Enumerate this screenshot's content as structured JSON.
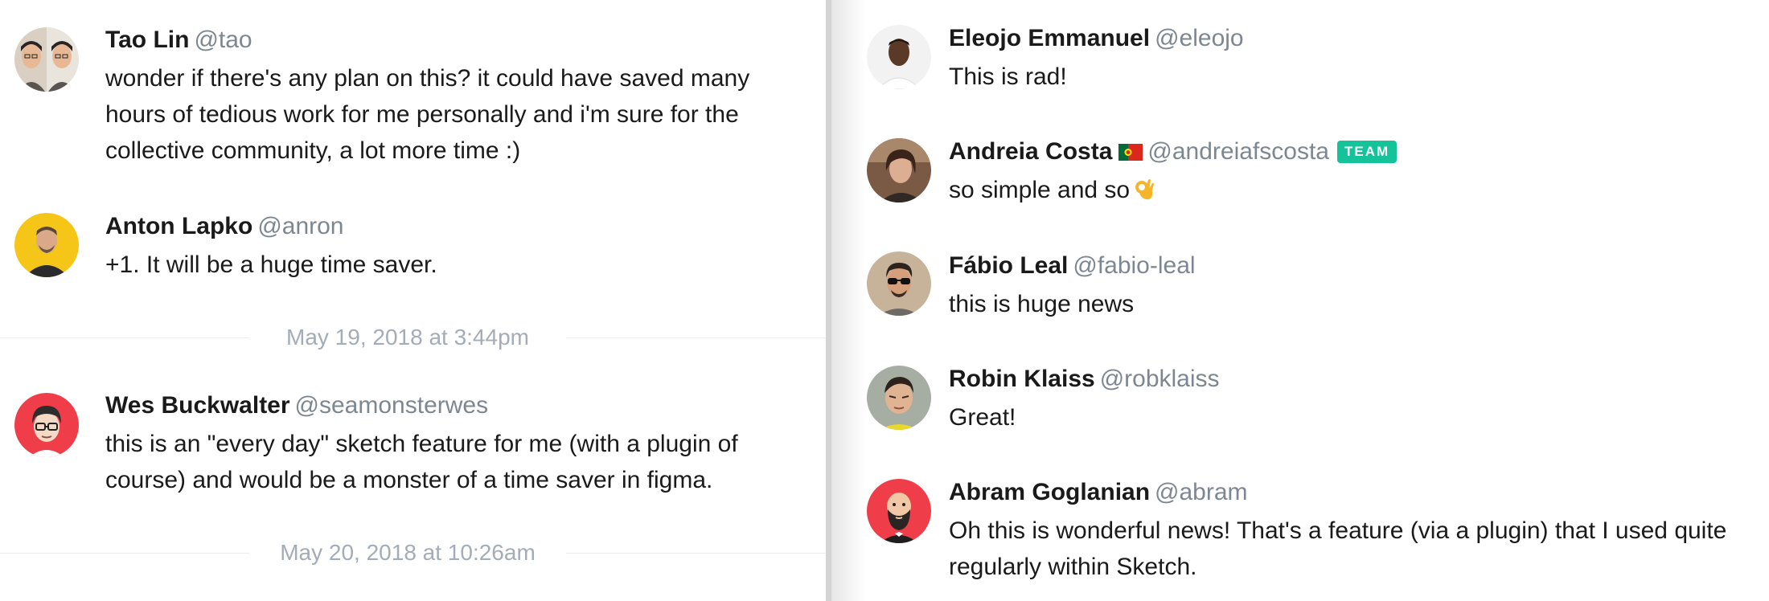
{
  "left_comments": [
    {
      "author": "Tao Lin",
      "handle": "@tao",
      "body": "wonder if there's any plan on this? it could have saved many hours of tedious work for me personally and i'm sure for the collective community, a lot more time :)"
    },
    {
      "author": "Anton Lapko",
      "handle": "@anron",
      "body": "+1. It will be a huge time saver."
    },
    {
      "author": "Wes Buckwalter",
      "handle": "@seamonsterwes",
      "body": "this is an \"every day\" sketch feature for me (with a plugin of course) and would be a monster of a time saver in figma."
    }
  ],
  "dividers": [
    {
      "date": "May 19, 2018 at 3:44pm"
    },
    {
      "date": "May 20, 2018 at 10:26am"
    }
  ],
  "right_comments": [
    {
      "author": "Eleojo Emmanuel",
      "handle": "@eleojo",
      "body": "This is rad!"
    },
    {
      "author": "Andreia Costa",
      "handle": "@andreiafscosta",
      "badge": "TEAM",
      "body": "so simple and so",
      "body_emoji": "ok-hand-emoji"
    },
    {
      "author": "Fábio Leal",
      "handle": "@fabio-leal",
      "body": "this is huge news"
    },
    {
      "author": "Robin Klaiss",
      "handle": "@robklaiss",
      "body": "Great!"
    },
    {
      "author": "Abram Goglanian",
      "handle": "@abram",
      "body": "Oh this is wonderful news! That's a feature (via a plugin) that I used quite regularly within Sketch."
    }
  ],
  "icons": {
    "flag": "portugal-flag-icon",
    "emoji": "ok-hand-emoji"
  },
  "colors": {
    "team_badge": "#15c39a",
    "handle": "#7d8791",
    "date": "#a3acb7"
  }
}
